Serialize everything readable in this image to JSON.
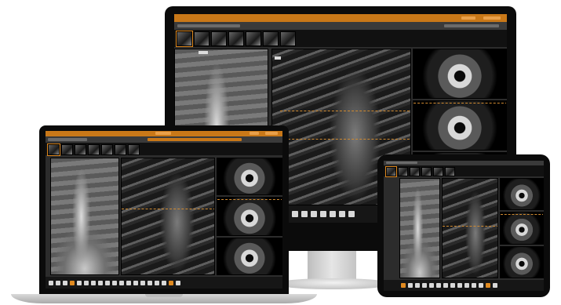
{
  "devices": {
    "monitor": {
      "header_logo": "",
      "header_message": "",
      "viewport_label": "",
      "toolbar": []
    },
    "laptop": {
      "viewport_label": "",
      "toolbar": []
    },
    "tablet": {
      "toolbar": []
    }
  },
  "colors": {
    "accent": "#c97818",
    "bezel": "#0b0b0b",
    "screen_bg": "#2c2c2c",
    "stand": "#cfcfcf"
  },
  "icons": {
    "toolbar": [
      "arrow-icon",
      "zoom-icon",
      "ruler-icon",
      "window-level-icon",
      "layout-1x1-icon",
      "layout-2x2-icon",
      "annotate-icon",
      "cine-icon",
      "settings-icon"
    ]
  }
}
